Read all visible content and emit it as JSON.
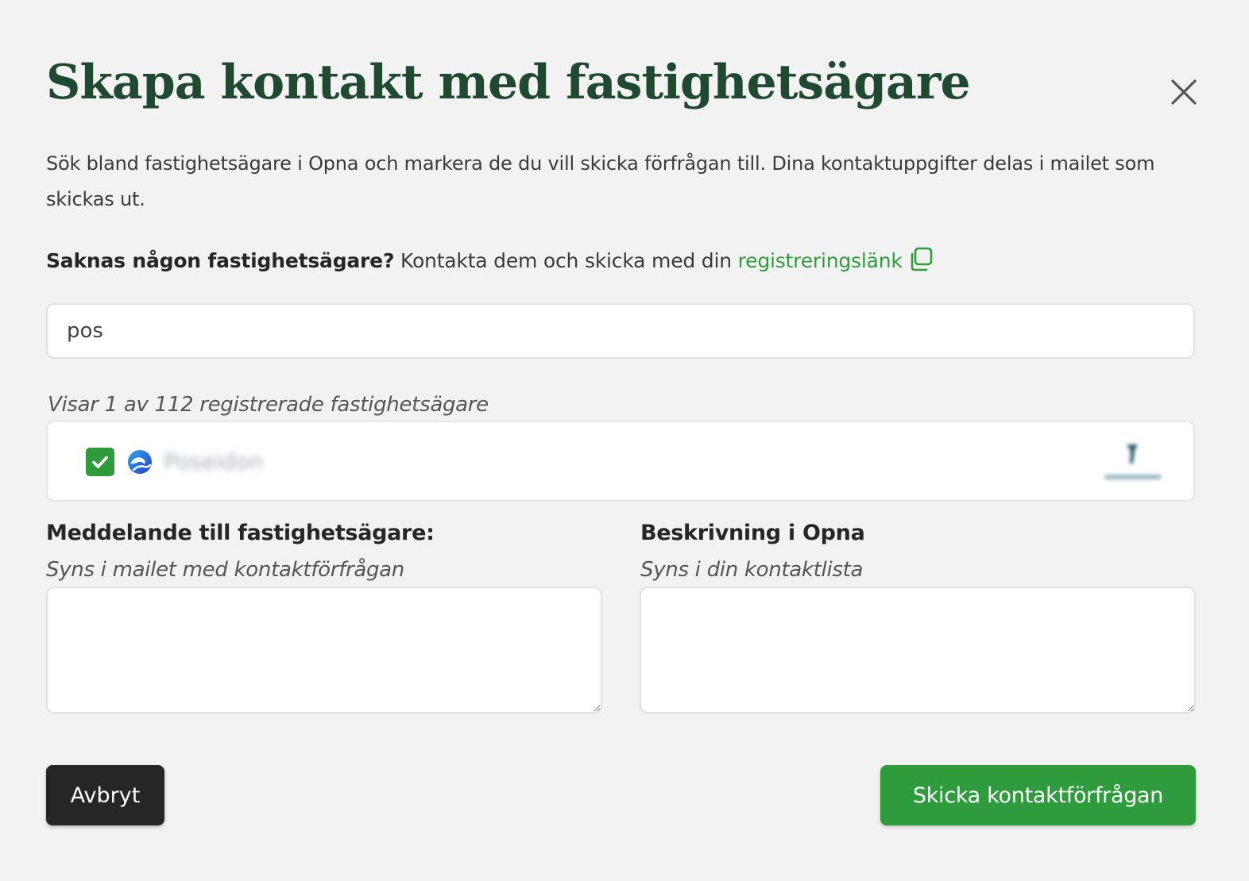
{
  "dialog": {
    "title": "Skapa kontakt med fastighetsägare",
    "intro": "Sök bland fastighetsägare i Opna och markera de du vill skicka förfrågan till. Dina kontaktuppgifter delas i mailet som skickas ut.",
    "missing_prefix": "Saknas någon fastighetsägare?",
    "missing_text": "Kontakta dem och skicka med din",
    "registration_link": "registreringslänk",
    "copy_icon": "copy-icon",
    "close_icon": "close-icon"
  },
  "search": {
    "value": "pos"
  },
  "results": {
    "summary": "Visar 1 av 112 registrerade fastighetsägare",
    "items": [
      {
        "name": "Poseidon",
        "checked": true
      }
    ]
  },
  "message": {
    "label": "Meddelande till fastighetsägare:",
    "hint": "Syns i mailet med kontaktförfrågan",
    "value": ""
  },
  "description": {
    "label": "Beskrivning i Opna",
    "hint": "Syns i din kontaktlista",
    "value": ""
  },
  "actions": {
    "cancel_label": "Avbryt",
    "send_label": "Skicka kontaktförfrågan"
  },
  "colors": {
    "title": "#1f4a30",
    "accent": "#2e9c3c",
    "link": "#2f9e3a",
    "cancel_bg": "#262626",
    "background": "#f2f2f2"
  }
}
